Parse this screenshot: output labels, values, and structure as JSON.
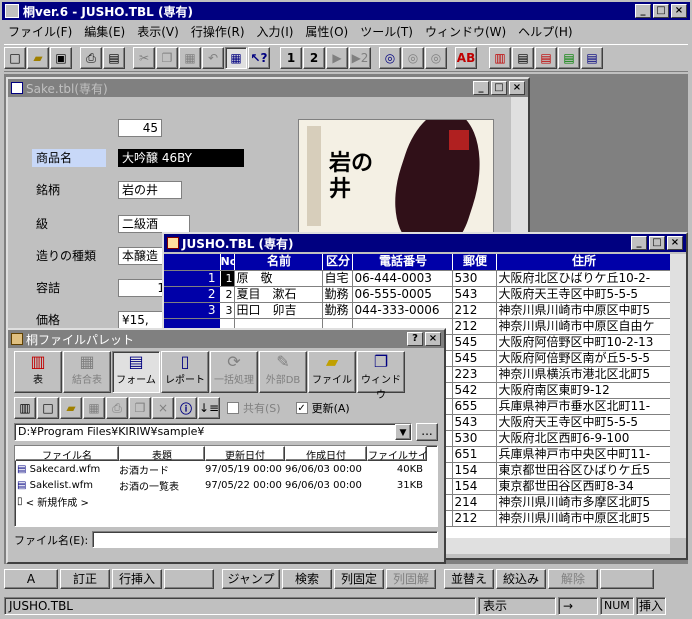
{
  "main": {
    "title": "桐ver.6 - JUSHO.TBL (専有)"
  },
  "menu": [
    "ファイル(F)",
    "編集(E)",
    "表示(V)",
    "行操作(R)",
    "入力(I)",
    "属性(O)",
    "ツール(T)",
    "ウィンドウ(W)",
    "ヘルプ(H)"
  ],
  "sake": {
    "title": "Sake.tbl(専有)",
    "number": "45",
    "labels": [
      "商品名",
      "銘柄",
      "級",
      "造りの種類",
      "容詰",
      "価格"
    ],
    "values": [
      "大吟醸 46BY",
      "岩の井",
      "二級酒",
      "本醸造",
      "1",
      "¥15,"
    ],
    "label_poster": "岩の井"
  },
  "jusho": {
    "title": "JUSHO.TBL (専有)",
    "headers": [
      "No",
      "名前",
      "区分",
      "電話番号",
      "郵便",
      "住所"
    ],
    "rows": [
      {
        "rn": "1",
        "no": "1",
        "name": "原　敬",
        "kubun": "自宅",
        "tel": "06-444-0003",
        "post": "530",
        "addr": "大阪府北区ひばりケ丘10-2-"
      },
      {
        "rn": "2",
        "no": "2",
        "name": "夏目　漱石",
        "kubun": "勤務",
        "tel": "06-555-0005",
        "post": "543",
        "addr": "大阪府天王寺区中町5-5-5"
      },
      {
        "rn": "3",
        "no": "3",
        "name": "田口　卯吉",
        "kubun": "勤務",
        "tel": "044-333-0006",
        "post": "212",
        "addr": "神奈川県川崎市中原区中町5"
      },
      {
        "rn": "",
        "no": "",
        "name": "",
        "kubun": "",
        "tel": "",
        "post": "212",
        "addr": "神奈川県川崎市中原区自由ケ"
      },
      {
        "rn": "",
        "no": "",
        "name": "",
        "kubun": "",
        "tel": "",
        "post": "545",
        "addr": "大阪府阿倍野区中町10-2-13"
      },
      {
        "rn": "",
        "no": "",
        "name": "",
        "kubun": "",
        "tel": "",
        "post": "545",
        "addr": "大阪府阿倍野区南が丘5-5-5"
      },
      {
        "rn": "",
        "no": "",
        "name": "",
        "kubun": "",
        "tel": "",
        "post": "223",
        "addr": "神奈川県横浜市港北区北町5"
      },
      {
        "rn": "",
        "no": "",
        "name": "",
        "kubun": "",
        "tel": "",
        "post": "542",
        "addr": "大阪府南区東町9-12"
      },
      {
        "rn": "",
        "no": "",
        "name": "",
        "kubun": "",
        "tel": "",
        "post": "655",
        "addr": "兵庫県神戸市垂水区北町11-"
      },
      {
        "rn": "",
        "no": "",
        "name": "",
        "kubun": "",
        "tel": "",
        "post": "543",
        "addr": "大阪府天王寺区中町5-5-5"
      },
      {
        "rn": "",
        "no": "",
        "name": "",
        "kubun": "",
        "tel": "",
        "post": "530",
        "addr": "大阪府北区西町6-9-100"
      },
      {
        "rn": "",
        "no": "",
        "name": "",
        "kubun": "",
        "tel": "",
        "post": "651",
        "addr": "兵庫県神戸市中央区中町11-"
      },
      {
        "rn": "",
        "no": "",
        "name": "",
        "kubun": "",
        "tel": "",
        "post": "154",
        "addr": "東京都世田谷区ひばりケ丘5"
      },
      {
        "rn": "",
        "no": "",
        "name": "",
        "kubun": "",
        "tel": "",
        "post": "154",
        "addr": "東京都世田谷区西町8-34"
      },
      {
        "rn": "",
        "no": "",
        "name": "",
        "kubun": "",
        "tel": "",
        "post": "214",
        "addr": "神奈川県川崎市多摩区北町5"
      },
      {
        "rn": "",
        "no": "",
        "name": "",
        "kubun": "",
        "tel": "",
        "post": "212",
        "addr": "神奈川県川崎市中原区北町5"
      }
    ]
  },
  "palette": {
    "title": "桐ファイルパレット",
    "big_buttons": [
      "表",
      "結合表",
      "フォーム",
      "レポート",
      "一括処理",
      "外部DB",
      "ファイル",
      "ウィンドウ"
    ],
    "shared_label": "共有(S)",
    "update_label": "更新(A)",
    "path": "D:¥Program Files¥KIRIW¥sample¥",
    "browse": "...",
    "cols": [
      "ファイル名",
      "表題",
      "更新日付",
      "作成日付",
      "ファイルサイズ"
    ],
    "files": [
      {
        "name": "Sakecard.wfm",
        "title": "お酒カード",
        "updated": "97/05/19 00:00",
        "created": "96/06/03 00:00",
        "size": "40KB"
      },
      {
        "name": "Sakelist.wfm",
        "title": "お酒の一覧表",
        "updated": "97/05/22 00:00",
        "created": "96/06/03 00:00",
        "size": "31KB"
      }
    ],
    "new_item": "< 新規作成 >",
    "filename_label": "ファイル名(E):"
  },
  "fkeys": [
    "A",
    "訂正",
    "行挿入",
    "",
    "ジャンプ",
    "検索",
    "列固定",
    "列固解",
    "並替え",
    "絞込み",
    "解除",
    ""
  ],
  "status": {
    "left": "JUSHO.TBL",
    "mode": "表示",
    "arrow": "→",
    "num": "NUM",
    "ins": "挿入"
  }
}
